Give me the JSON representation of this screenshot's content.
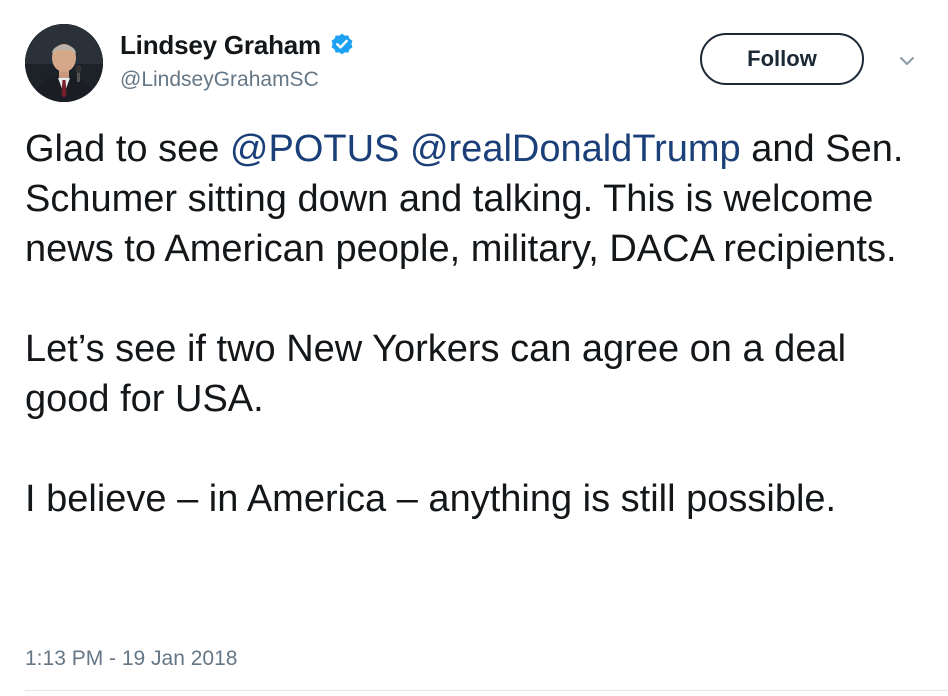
{
  "author": {
    "display_name": "Lindsey Graham",
    "handle": "@LindseyGrahamSC",
    "verified": true,
    "avatar_icon": "profile-photo"
  },
  "actions": {
    "follow_label": "Follow",
    "caret_icon": "chevron-down-icon"
  },
  "tweet": {
    "p1": {
      "t1": "Glad to see ",
      "m1": "@POTUS",
      "t2": " ",
      "m2": "@realDonaldTrump",
      "t3": " and Sen. Schumer sitting down and talking. This is welcome news to American people, military, DACA recipients."
    },
    "p2": "Let’s see if two New Yorkers can agree on a deal good for USA.",
    "p3": "I believe – in America – anything is still possible."
  },
  "timestamp": "1:13 PM - 19 Jan 2018",
  "colors": {
    "mention": "#1b3f78",
    "verified_badge": "#1da1f2",
    "secondary_text": "#657786",
    "follow_border": "#1b2836"
  }
}
